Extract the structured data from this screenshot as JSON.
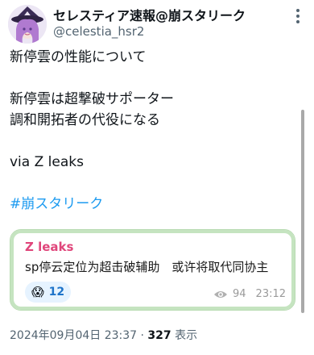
{
  "header": {
    "display_name": "セレスティア速報@崩スタリーク",
    "handle": "@celestia_hsr2"
  },
  "tweet": {
    "line1": "新停雲の性能について",
    "line2": "新停雲は超撃破サポーター",
    "line3": "調和開拓者の代役になる",
    "line4": "via Z leaks",
    "hashtag": "#崩スタリーク"
  },
  "embed": {
    "title": "Z leaks",
    "text": "sp停云定位为超击破辅助　或许将取代同协主",
    "reaction_emoji": "😱",
    "reaction_count": "12",
    "views": "94",
    "time": "23:12"
  },
  "meta": {
    "timestamp": "2024年09月04日 23:37",
    "separator": "·",
    "views_count": "327",
    "views_label": "表示"
  },
  "icons": {
    "more": "more-vertical-icon",
    "eye": "eye-icon"
  },
  "colors": {
    "hashtag": "#1d9bf0",
    "embed_title": "#e0467b",
    "embed_border": "#c5e4c0"
  }
}
